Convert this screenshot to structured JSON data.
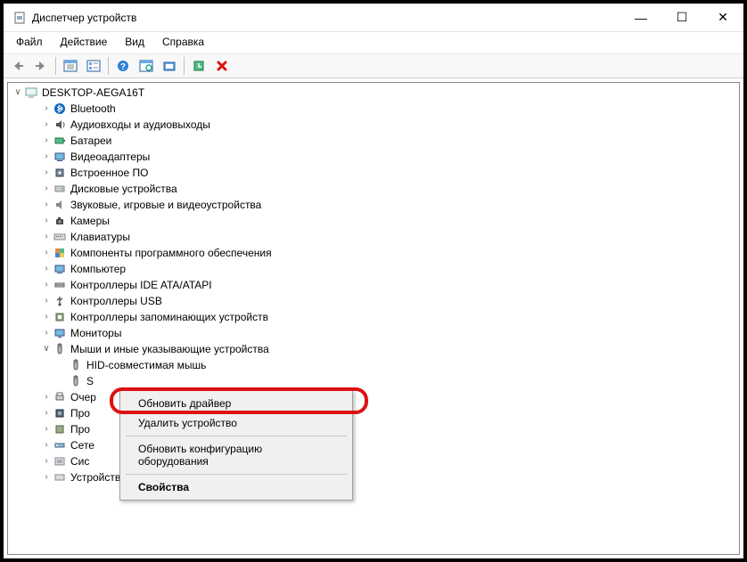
{
  "window": {
    "title": "Диспетчер устройств"
  },
  "menubar": [
    "Файл",
    "Действие",
    "Вид",
    "Справка"
  ],
  "tree": {
    "root": "DESKTOP-AEGA16T",
    "nodes": [
      {
        "label": "Bluetooth",
        "expanded": false
      },
      {
        "label": "Аудиовходы и аудиовыходы",
        "expanded": false
      },
      {
        "label": "Батареи",
        "expanded": false
      },
      {
        "label": "Видеоадаптеры",
        "expanded": false
      },
      {
        "label": "Встроенное ПО",
        "expanded": false
      },
      {
        "label": "Дисковые устройства",
        "expanded": false
      },
      {
        "label": "Звуковые, игровые и видеоустройства",
        "expanded": false
      },
      {
        "label": "Камеры",
        "expanded": false
      },
      {
        "label": "Клавиатуры",
        "expanded": false
      },
      {
        "label": "Компоненты программного обеспечения",
        "expanded": false
      },
      {
        "label": "Компьютер",
        "expanded": false
      },
      {
        "label": "Контроллеры IDE ATA/ATAPI",
        "expanded": false
      },
      {
        "label": "Контроллеры USB",
        "expanded": false
      },
      {
        "label": "Контроллеры запоминающих устройств",
        "expanded": false
      },
      {
        "label": "Мониторы",
        "expanded": false
      },
      {
        "label": "Мыши и иные указывающие устройства",
        "expanded": true,
        "children": [
          {
            "label": "HID-совместимая мышь"
          },
          {
            "label": "S"
          }
        ]
      },
      {
        "label": "Очер",
        "expanded": false
      },
      {
        "label": "Про",
        "expanded": false
      },
      {
        "label": "Про",
        "expanded": false
      },
      {
        "label": "Сете",
        "expanded": false
      },
      {
        "label": "Сис",
        "expanded": false
      },
      {
        "label": "Устройства HID (Human Interface Devices)",
        "expanded": false
      }
    ]
  },
  "context_menu": {
    "items": [
      {
        "label": "Обновить драйвер",
        "highlighted": true
      },
      {
        "label": "Удалить устройство"
      },
      {
        "sep": true
      },
      {
        "label": "Обновить конфигурацию оборудования"
      },
      {
        "sep": true
      },
      {
        "label": "Свойства",
        "default": true
      }
    ]
  },
  "icons": {
    "bluetooth": "#0a65c2",
    "red_x": "#d11"
  }
}
